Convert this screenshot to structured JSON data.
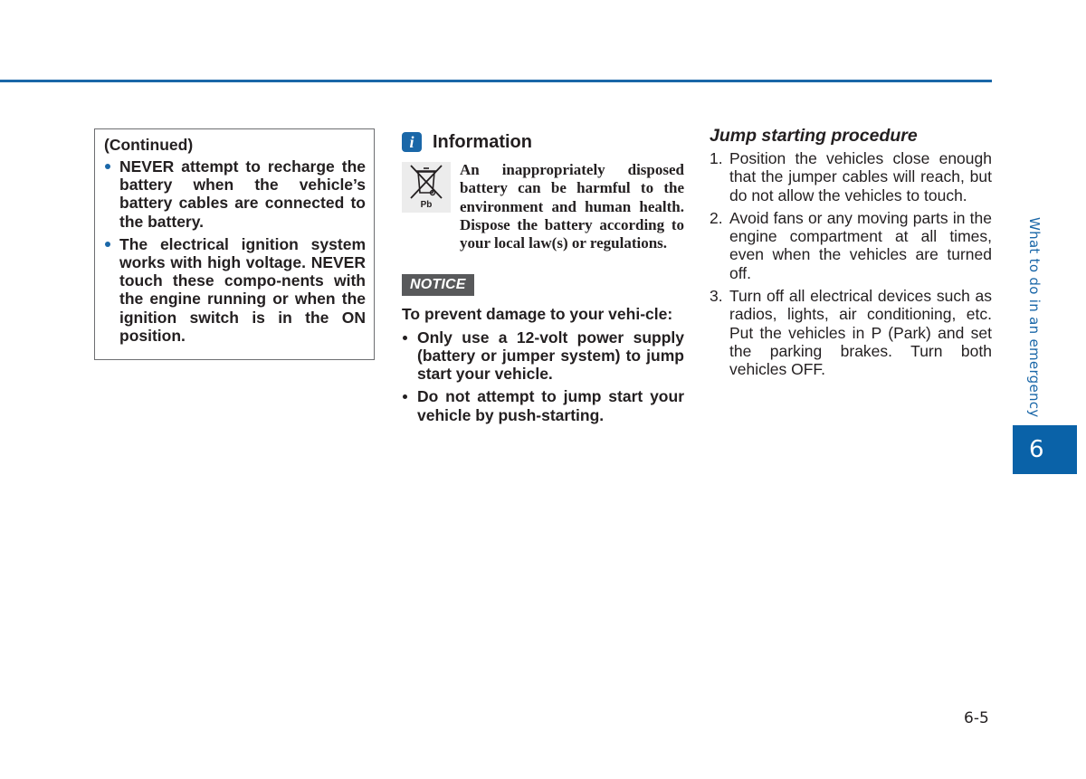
{
  "warning_box": {
    "heading": "(Continued)",
    "items": [
      "NEVER attempt to recharge the battery when the vehicle’s battery cables are connected to the battery.",
      "The electrical ignition system works with high voltage. NEVER touch these compo-nents with the engine running or when the ignition switch is in the ON position."
    ]
  },
  "information": {
    "icon_glyph": "i",
    "title": "Information",
    "symbol_label": "Pb",
    "symbol_icon": "crossed-out-bin-icon",
    "text": "An inappropriately disposed battery can be harmful to the environment and human health. Dispose the battery according to your local law(s) or regulations."
  },
  "notice": {
    "badge": "NOTICE",
    "lead": "To prevent damage to your vehi-cle:",
    "items": [
      "Only use a 12-volt power supply (battery or jumper system) to jump start your vehicle.",
      "Do not attempt to jump start your vehicle by push-starting."
    ]
  },
  "procedure": {
    "title": "Jump starting procedure",
    "steps": [
      {
        "num": "1.",
        "text": "Position the vehicles close enough that the jumper cables will reach, but do not allow the vehicles to touch."
      },
      {
        "num": "2.",
        "text": "Avoid fans or any moving parts in the engine compartment at all times, even when the vehicles are turned off."
      },
      {
        "num": "3.",
        "text": "Turn off all electrical devices such as radios, lights, air conditioning, etc. Put the vehicles in P (Park) and set the parking brakes. Turn both vehicles OFF."
      }
    ]
  },
  "side_tab": {
    "section_label": "What to do in an emergency",
    "chapter": "6"
  },
  "page_number": "6-5",
  "colors": {
    "accent_blue": "#1a67a8",
    "tab_blue": "#0a62a8",
    "notice_gray": "#58595b"
  }
}
